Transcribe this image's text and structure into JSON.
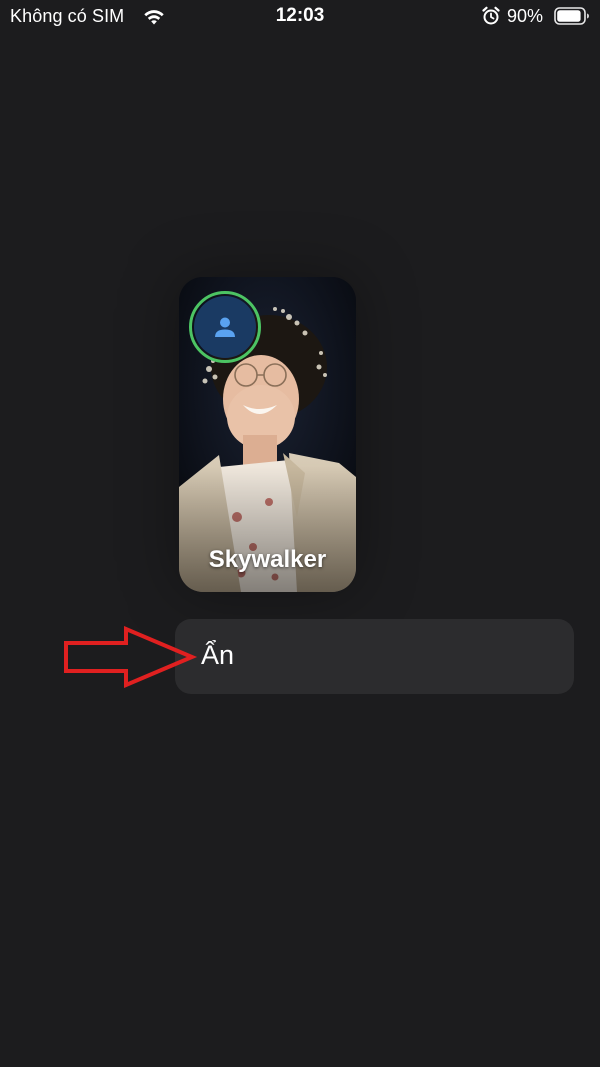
{
  "status_bar": {
    "carrier": "Không có SIM",
    "time": "12:03",
    "battery_percent": "90%",
    "battery_level": 0.9,
    "icons": [
      "wifi-icon",
      "alarm-icon",
      "battery-icon"
    ]
  },
  "contact_card": {
    "name": "Skywalker",
    "avatar_icon": "person-icon",
    "avatar_ring_color": "#4cc463",
    "avatar_bg_color": "#1a3a63"
  },
  "menu": {
    "hide_label": "Ẩn"
  },
  "annotation": {
    "arrow_color": "#e02020",
    "arrow_icon": "arrow-right-icon"
  }
}
